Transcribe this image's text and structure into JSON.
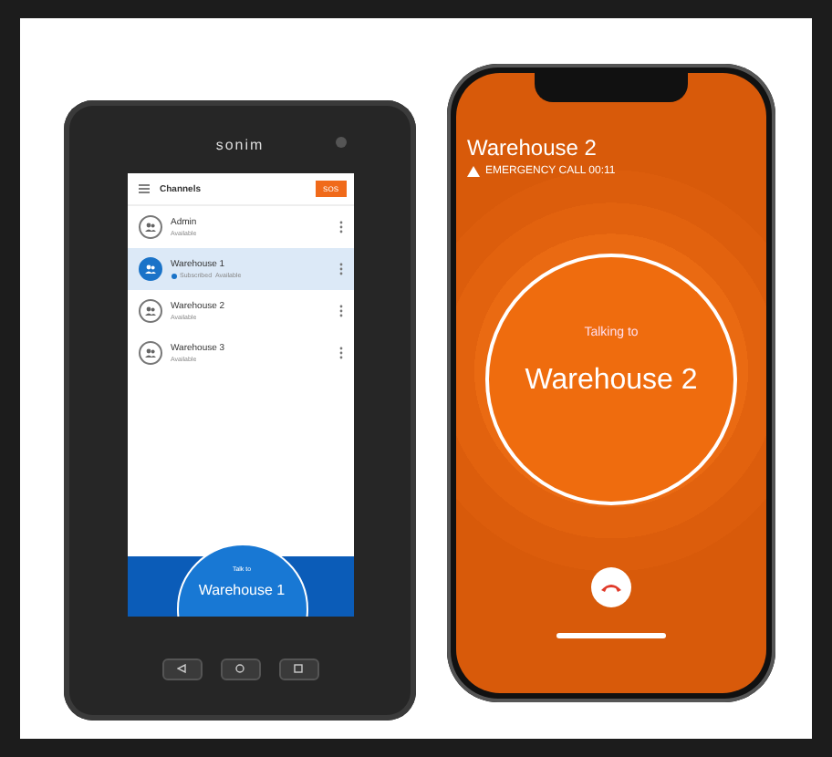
{
  "left_phone": {
    "brand": "sonim",
    "header": {
      "title": "Channels",
      "action": "SOS"
    },
    "channels": [
      {
        "name": "Admin",
        "status": "Available",
        "subscribed": false,
        "selected": false
      },
      {
        "name": "Warehouse 1",
        "status": "Available",
        "subscribed": true,
        "subscribed_label": "Subscribed",
        "selected": true
      },
      {
        "name": "Warehouse 2",
        "status": "Available",
        "subscribed": false,
        "selected": false
      },
      {
        "name": "Warehouse 3",
        "status": "Available",
        "subscribed": false,
        "selected": false
      }
    ],
    "talk_button": {
      "caption": "Talk to",
      "channel": "Warehouse 1"
    }
  },
  "right_phone": {
    "title": "Warehouse 2",
    "alert": "EMERGENCY CALL 00:11",
    "talk_circle": {
      "caption": "Talking to",
      "channel": "Warehouse 2"
    }
  }
}
